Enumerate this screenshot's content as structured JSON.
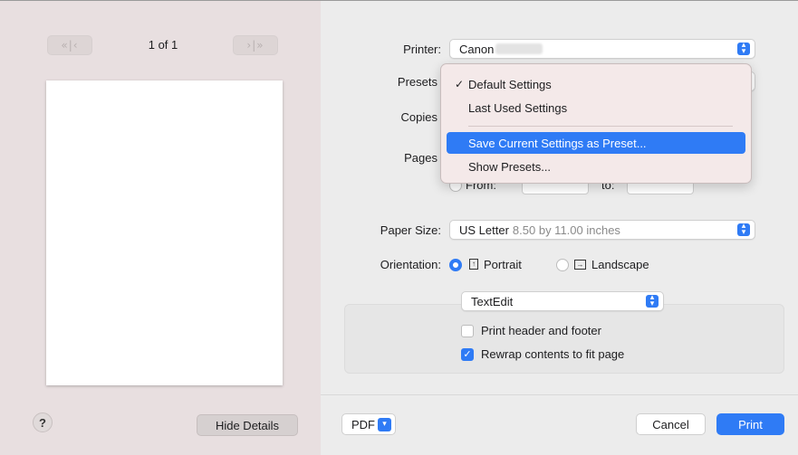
{
  "preview": {
    "first_prev_icon": "«|‹",
    "next_last_icon": "›|»",
    "page_counter": "1 of 1",
    "help_label": "?",
    "hide_details_label": "Hide Details"
  },
  "settings": {
    "printer": {
      "label": "Printer:",
      "value": "Canon"
    },
    "presets": {
      "label": "Presets"
    },
    "copies": {
      "label": "Copies"
    },
    "pages": {
      "label": "Pages",
      "from_label": "From:",
      "to_label": "to:"
    },
    "paper_size": {
      "label": "Paper Size:",
      "value": "US Letter",
      "detail": "8.50 by 11.00 inches"
    },
    "orientation": {
      "label": "Orientation:",
      "options": [
        {
          "label": "Portrait",
          "selected": true
        },
        {
          "label": "Landscape",
          "selected": false
        }
      ]
    },
    "app_section": {
      "value": "TextEdit",
      "checkboxes": [
        {
          "label": "Print header and footer",
          "checked": false
        },
        {
          "label": "Rewrap contents to fit page",
          "checked": true
        }
      ]
    }
  },
  "presets_menu": {
    "items": [
      {
        "label": "Default Settings",
        "checked": true,
        "highlighted": false
      },
      {
        "label": "Last Used Settings",
        "checked": false,
        "highlighted": false
      },
      {
        "label": "Save Current Settings as Preset...",
        "checked": false,
        "highlighted": true
      },
      {
        "label": "Show Presets...",
        "checked": false,
        "highlighted": false
      }
    ]
  },
  "footer": {
    "pdf_label": "PDF",
    "cancel_label": "Cancel",
    "print_label": "Print"
  },
  "colors": {
    "accent": "#2f7bf5",
    "preview_background": "#e8dfe0",
    "dialog_background": "#ececec"
  }
}
